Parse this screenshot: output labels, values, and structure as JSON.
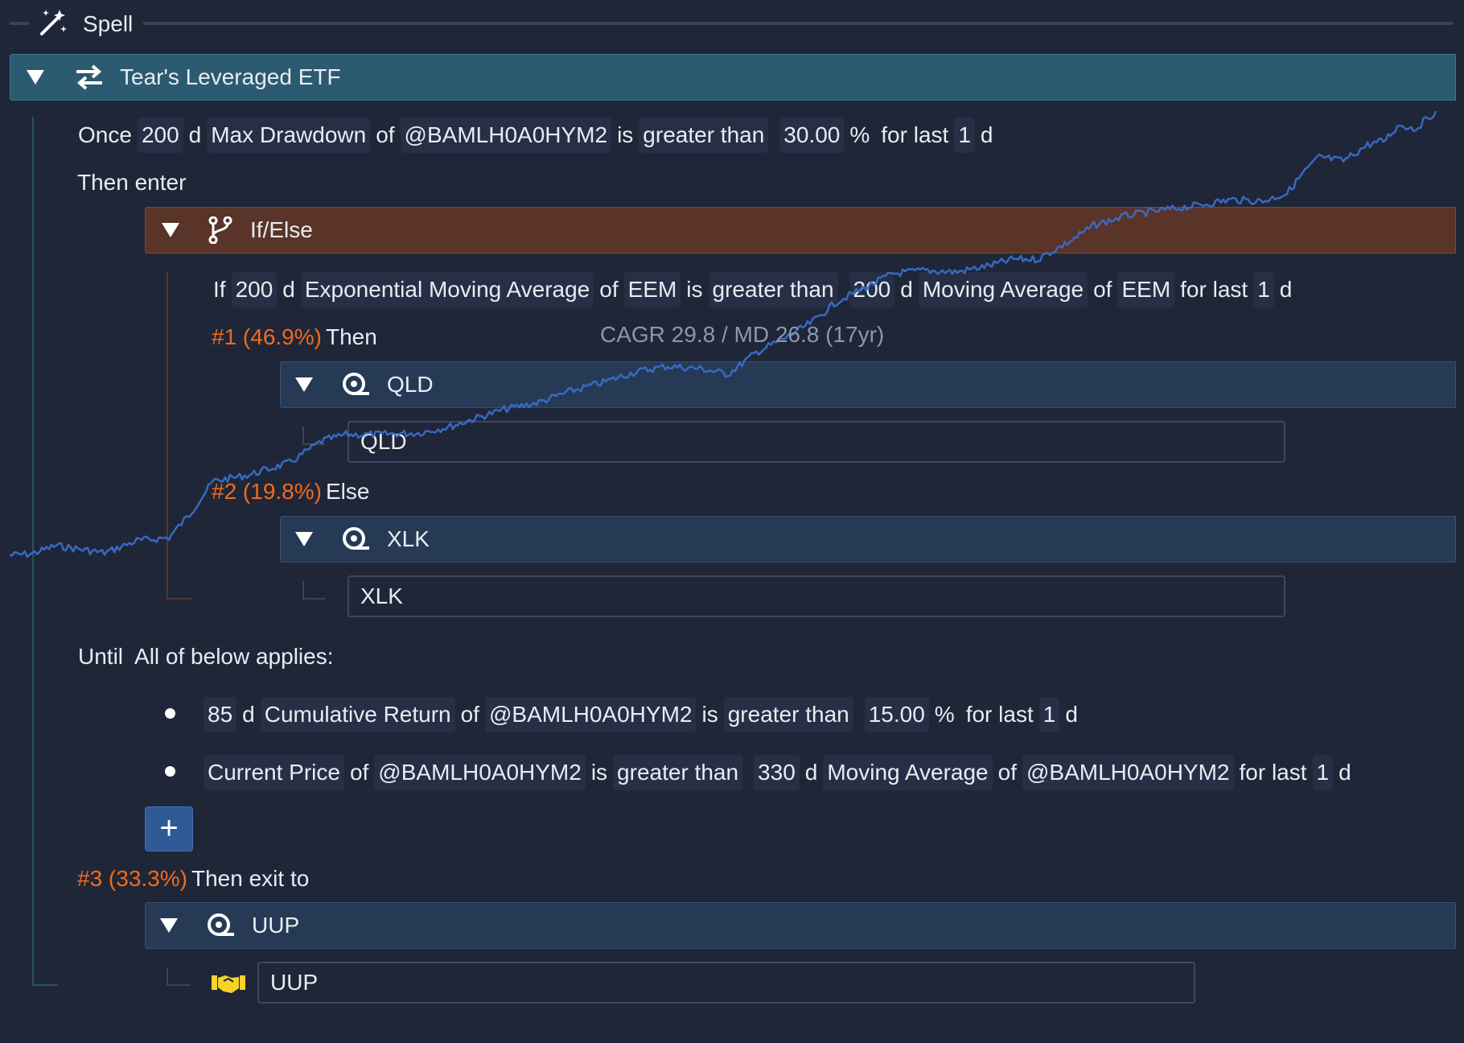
{
  "header": {
    "title": "Spell",
    "icon": "magic-wand-icon"
  },
  "main_block": {
    "title": "Tear's Leveraged ETF",
    "icon": "swap-arrows-icon",
    "color": "#2c5a70"
  },
  "once_condition": [
    "Once",
    "200",
    "d",
    "Max Drawdown",
    "of",
    "@BAMLH0A0HYM2",
    "is",
    "greater than",
    "30.00",
    "%",
    "for last",
    "1",
    "d"
  ],
  "then_enter_label": "Then enter",
  "ifelse": {
    "title": "If/Else",
    "icon": "branch-icon",
    "color": "#5a3428",
    "condition": [
      "If",
      "200",
      "d",
      "Exponential Moving Average",
      "of",
      "EEM",
      "is",
      "greater than",
      "200",
      "d",
      "Moving Average",
      "of",
      "EEM",
      "for last",
      "1",
      "d"
    ],
    "then_branch": {
      "tag": "#1 (46.9%)",
      "label": "Then",
      "asset_title": "QLD",
      "asset_value": "QLD"
    },
    "else_branch": {
      "tag": "#2 (19.8%)",
      "label": "Else",
      "asset_title": "XLK",
      "asset_value": "XLK"
    }
  },
  "overlay": {
    "stats": "CAGR 29.8 / MD 26.8 (17yr)",
    "line_color": "#3a6bc8"
  },
  "until": {
    "label": "Until",
    "sublabel": "All of below applies:",
    "conditions": [
      [
        "85",
        "d",
        "Cumulative Return",
        "of",
        "@BAMLH0A0HYM2",
        "is",
        "greater than",
        "15.00",
        "%",
        "for last",
        "1",
        "d"
      ],
      [
        "Current Price",
        "of",
        "@BAMLH0A0HYM2",
        "is",
        "greater than",
        "330",
        "d",
        "Moving Average",
        "of",
        "@BAMLH0A0HYM2",
        "for last",
        "1",
        "d"
      ]
    ],
    "add_button": "+"
  },
  "exit": {
    "tag": "#3 (33.3%)",
    "label": "Then exit to",
    "asset_title": "UUP",
    "asset_value": "UUP",
    "asset_icon": "handshake-icon"
  },
  "asset_icon": "coin-icon",
  "accent_orange": "#f26a1b",
  "asset_bar_color": "#273a55"
}
